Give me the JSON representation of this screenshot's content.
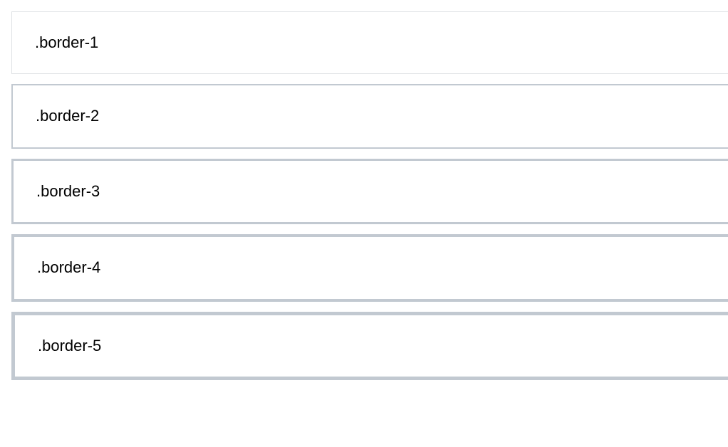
{
  "boxes": {
    "b1": {
      "label": ".border-1",
      "border_px": 1,
      "class_name": "border-1"
    },
    "b2": {
      "label": ".border-2",
      "border_px": 2,
      "class_name": "border-2"
    },
    "b3": {
      "label": ".border-3",
      "border_px": 3,
      "class_name": "border-3"
    },
    "b4": {
      "label": ".border-4",
      "border_px": 4,
      "class_name": "border-4"
    },
    "b5": {
      "label": ".border-5",
      "border_px": 5,
      "class_name": "border-5"
    }
  }
}
